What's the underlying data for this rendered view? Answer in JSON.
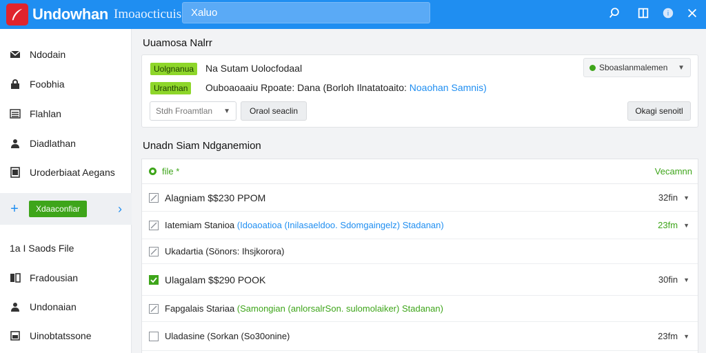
{
  "header": {
    "app_name": "Undowhan",
    "app_subtitle": "Imoaocticuis",
    "search_value": "Xaluo"
  },
  "sidebar": {
    "items": [
      {
        "label": "Ndodain",
        "icon": "inbox-icon"
      },
      {
        "label": "Foobhia",
        "icon": "lock-icon"
      },
      {
        "label": "Flahlan",
        "icon": "list-icon"
      },
      {
        "label": "Diadlathan",
        "icon": "user-icon"
      },
      {
        "label": "Uroderbiaat Aegans",
        "icon": "document-icon"
      }
    ],
    "active_button": "Xdaaconfiar",
    "section_label": "1a  I Saods File",
    "lower_items": [
      {
        "label": "Fradousian",
        "icon": "pages-icon"
      },
      {
        "label": "Undonaian",
        "icon": "person-icon"
      },
      {
        "label": "Uinobtatssone",
        "icon": "grid-icon"
      }
    ]
  },
  "main": {
    "panel_title": "Uuamosa Nalrr",
    "panel": {
      "tag1": "Uolgnanua",
      "line1": "Na Sutam Uolocfodaal",
      "tag2": "Uranthan",
      "line2_text": "Ouboaoaaiu Rpoate: Dana (Borloh Ilnatatoaito:",
      "line2_link": "Noaohan Samnis)",
      "dropdown_label": "Sboaslanmalemen",
      "input_value": "Stdh Froamtlan",
      "button_left": "Oraol seaclin",
      "button_right": "Okagi senoitl"
    },
    "table_title": "Unadn Siam  Ndganemion",
    "table": {
      "header_left": "file *",
      "header_right": "Vecamnn",
      "rows": [
        {
          "parts": [
            "Alagniam $$230 PPOM"
          ],
          "meta": "32fin",
          "checked": false,
          "big": true
        },
        {
          "parts": [
            "Iatemiam Stanioa ",
            "(Idoaoatioa (Inilasaeldoo.",
            " Sdomgaingelz) Stadanan)"
          ],
          "meta": "23fm",
          "checked": false,
          "big": false
        },
        {
          "parts": [
            "Ukadartia (Sönors: Ihsjkorora)"
          ],
          "meta": "",
          "checked": false,
          "big": false
        },
        {
          "parts": [
            "Ulagalam $$290 POOK"
          ],
          "meta": "30fin",
          "checked": true,
          "big": true
        },
        {
          "parts": [
            "Fapgalais Stariaa ",
            "(Samongian (anlorsalrSon. sulomolaiker)",
            " Stadanan)"
          ],
          "meta": "",
          "checked": false,
          "big": false
        },
        {
          "parts": [
            "Uladasine (Sorkan (So30onine)"
          ],
          "meta": "23fm",
          "checked": false,
          "big": false
        }
      ]
    }
  }
}
